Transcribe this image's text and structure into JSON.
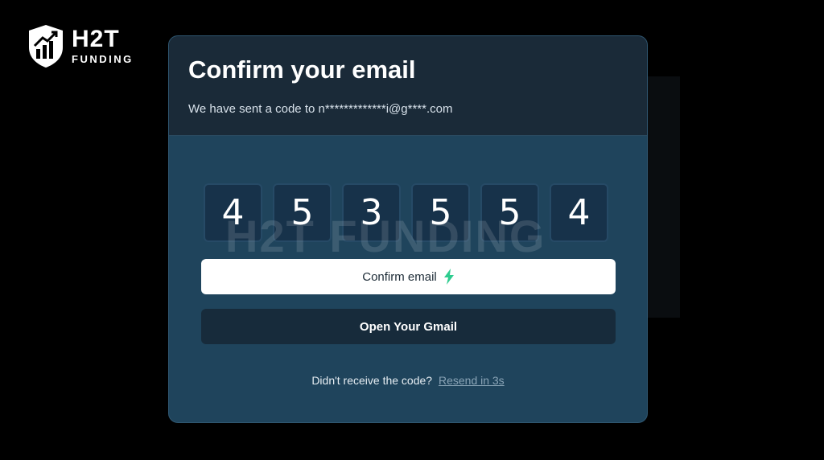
{
  "brand": {
    "logo_main": "H2T",
    "logo_sub": "FUNDING"
  },
  "modal": {
    "title": "Confirm your email",
    "subtitle": "We have sent a code to n*************i@g****.com",
    "code_digits": [
      "4",
      "5",
      "3",
      "5",
      "5",
      "4"
    ],
    "watermark": "H2T FUNDING",
    "confirm_label": "Confirm email",
    "gmail_label": "Open Your Gmail",
    "resend_prompt": "Didn't receive the code?",
    "resend_link": "Resend in 3s"
  },
  "colors": {
    "accent_bolt": "#2ecc8f",
    "modal_body": "#1f445c",
    "modal_header": "#1a2a38"
  }
}
